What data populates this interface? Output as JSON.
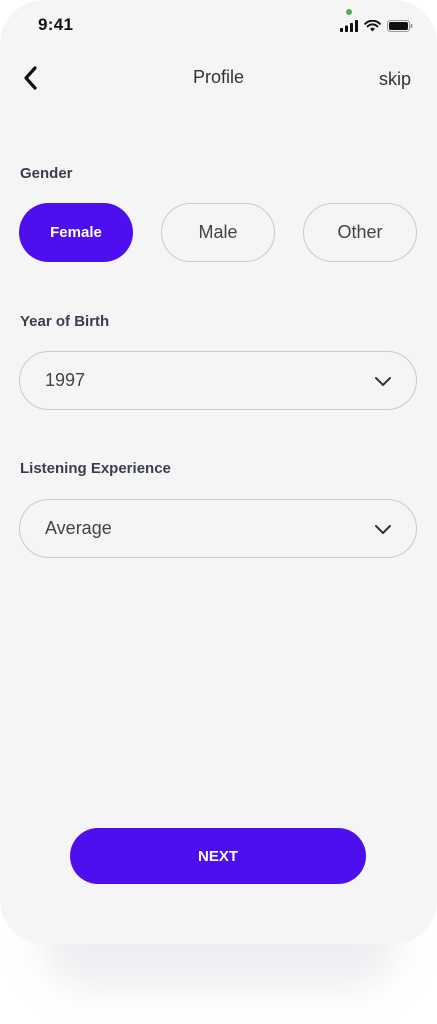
{
  "status_bar": {
    "time": "9:41",
    "camera_dot_color": "#4caf50",
    "icons": [
      "signal-icon",
      "wifi-icon",
      "battery-icon"
    ]
  },
  "header": {
    "back_icon": "chevron-left-icon",
    "title": "Profile",
    "skip_label": "skip"
  },
  "gender": {
    "label": "Gender",
    "options": [
      "Female",
      "Male",
      "Other"
    ],
    "selected": "Female"
  },
  "year_of_birth": {
    "label": "Year of Birth",
    "value": "1997"
  },
  "listening_experience": {
    "label": "Listening Experience",
    "value": "Average"
  },
  "next_button": {
    "label": "NEXT"
  },
  "colors": {
    "accent": "#4e0fef",
    "background": "#f5f5f5",
    "border": "#c9c9c9"
  }
}
